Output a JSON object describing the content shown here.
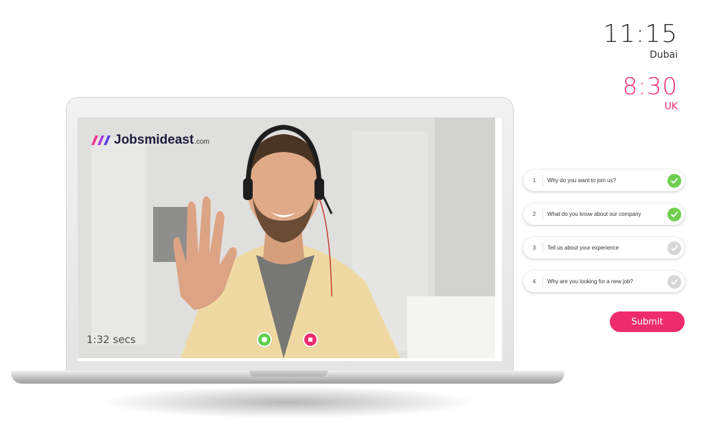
{
  "clocks": [
    {
      "time": "11:15",
      "city": "Dubai"
    },
    {
      "time": "8:30",
      "city": "UK"
    }
  ],
  "brand": {
    "name": "Jobsmideast",
    "domain": ".com",
    "accent": "#ee2c6d"
  },
  "recording": {
    "elapsed": "1:32 secs",
    "record_icon": "record-icon",
    "stop_icon": "stop-icon"
  },
  "questions": [
    {
      "number": "1",
      "text": "Why do you want to join us?",
      "answered": true
    },
    {
      "number": "2",
      "text": "What do you know about our company",
      "answered": true
    },
    {
      "number": "3",
      "text": "Tell us about your experience",
      "answered": false
    },
    {
      "number": "4",
      "text": "Why are you looking for a new job?",
      "answered": false
    }
  ],
  "submit_label": "Submit",
  "colors": {
    "answered": "#6fce4f",
    "pending": "#d6d6d6",
    "primary": "#ee2c6d"
  }
}
